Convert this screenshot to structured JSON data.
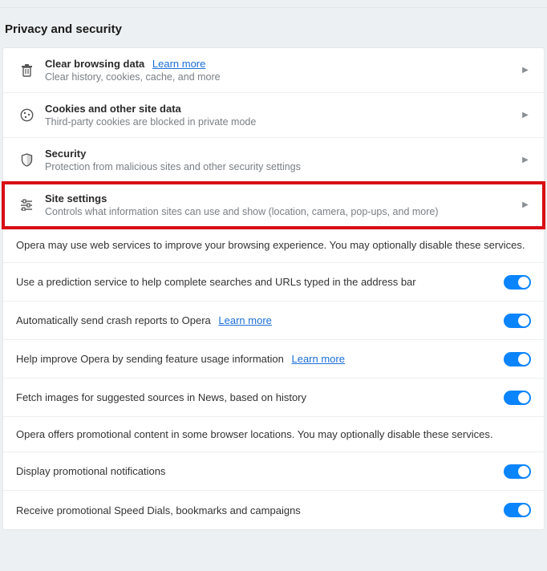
{
  "section_title": "Privacy and security",
  "nav_items": [
    {
      "title": "Clear browsing data",
      "subtitle": "Clear history, cookies, cache, and more",
      "learn_more": "Learn more"
    },
    {
      "title": "Cookies and other site data",
      "subtitle": "Third-party cookies are blocked in private mode"
    },
    {
      "title": "Security",
      "subtitle": "Protection from malicious sites and other security settings"
    },
    {
      "title": "Site settings",
      "subtitle": "Controls what information sites can use and show (location, camera, pop-ups, and more)"
    }
  ],
  "info_text_1": "Opera may use web services to improve your browsing experience. You may optionally disable these services.",
  "toggles_1": [
    {
      "label": "Use a prediction service to help complete searches and URLs typed in the address bar"
    },
    {
      "label": "Automatically send crash reports to Opera",
      "learn_more": "Learn more"
    },
    {
      "label": "Help improve Opera by sending feature usage information",
      "learn_more": "Learn more"
    },
    {
      "label": "Fetch images for suggested sources in News, based on history"
    }
  ],
  "info_text_2": "Opera offers promotional content in some browser locations. You may optionally disable these services.",
  "toggles_2": [
    {
      "label": "Display promotional notifications"
    },
    {
      "label": "Receive promotional Speed Dials, bookmarks and campaigns"
    }
  ]
}
